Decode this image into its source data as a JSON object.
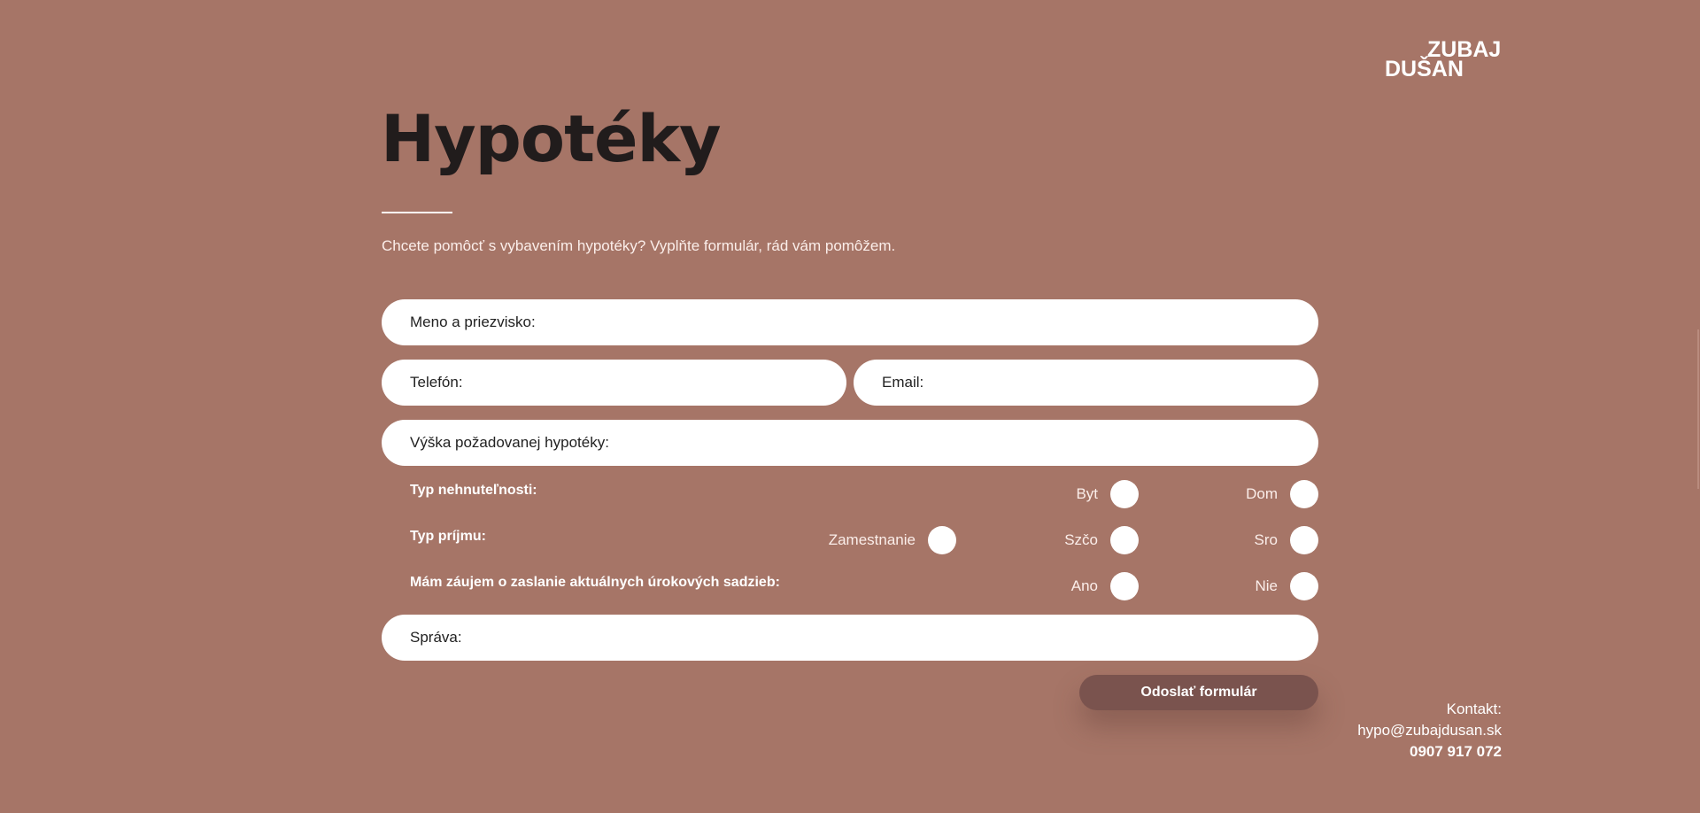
{
  "brand": {
    "line1": "ZUBAJ",
    "line2": "DUŠAN"
  },
  "page": {
    "title": "Hypotéky",
    "intro": "Chcete pomôcť s vybavením hypotéky? Vyplňte formulár, rád vám pomôžem."
  },
  "form": {
    "name_placeholder": "Meno a priezvisko:",
    "phone_placeholder": "Telefón:",
    "email_placeholder": "Email:",
    "amount_placeholder": "Výška požadovanej hypotéky:",
    "message_placeholder": "Správa:",
    "property_type": {
      "label": "Typ nehnuteľnosti:",
      "options": [
        "Byt",
        "Dom"
      ]
    },
    "income_type": {
      "label": "Typ príjmu:",
      "options": [
        "Zamestnanie",
        "Szčo",
        "Sro"
      ]
    },
    "rates_interest": {
      "label": "Mám záujem o zaslanie aktuálnych úrokových sadzieb:",
      "options": [
        "Ano",
        "Nie"
      ]
    },
    "submit_label": "Odoslať formulár"
  },
  "contact": {
    "label": "Kontakt:",
    "email": "hypo@zubajdusan.sk",
    "phone": "0907 917 072"
  }
}
